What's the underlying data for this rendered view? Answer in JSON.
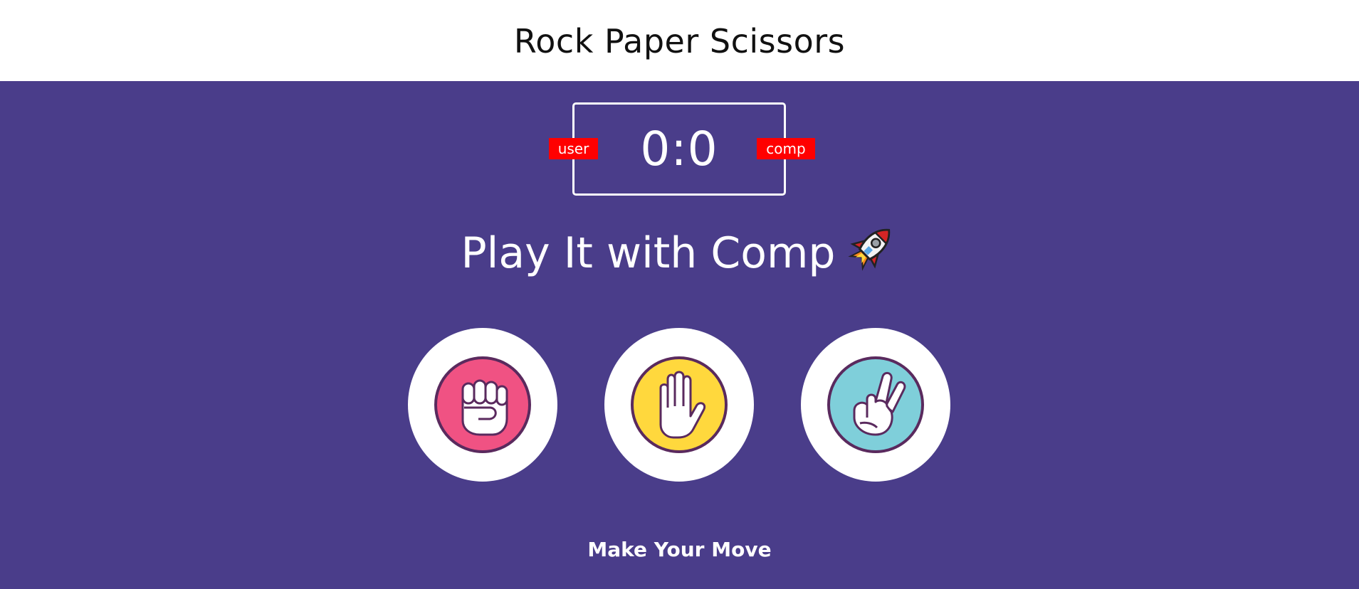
{
  "header": {
    "title": "Rock Paper Scissors"
  },
  "scoreboard": {
    "user_label": "user",
    "comp_label": "comp",
    "score": "0:0",
    "badge_color": "#ff0000"
  },
  "headline": {
    "text": "Play It with Comp",
    "icon": "rocket-icon"
  },
  "choices": [
    {
      "id": "rock",
      "icon": "fist-icon",
      "color": "#f05283"
    },
    {
      "id": "paper",
      "icon": "open-hand-icon",
      "color": "#ffd83d"
    },
    {
      "id": "scissors",
      "icon": "peace-hand-icon",
      "color": "#7fcfda"
    }
  ],
  "message": {
    "text": "Make Your Move"
  },
  "theme": {
    "background": "#4a3d8a",
    "header_background": "#ffffff"
  }
}
